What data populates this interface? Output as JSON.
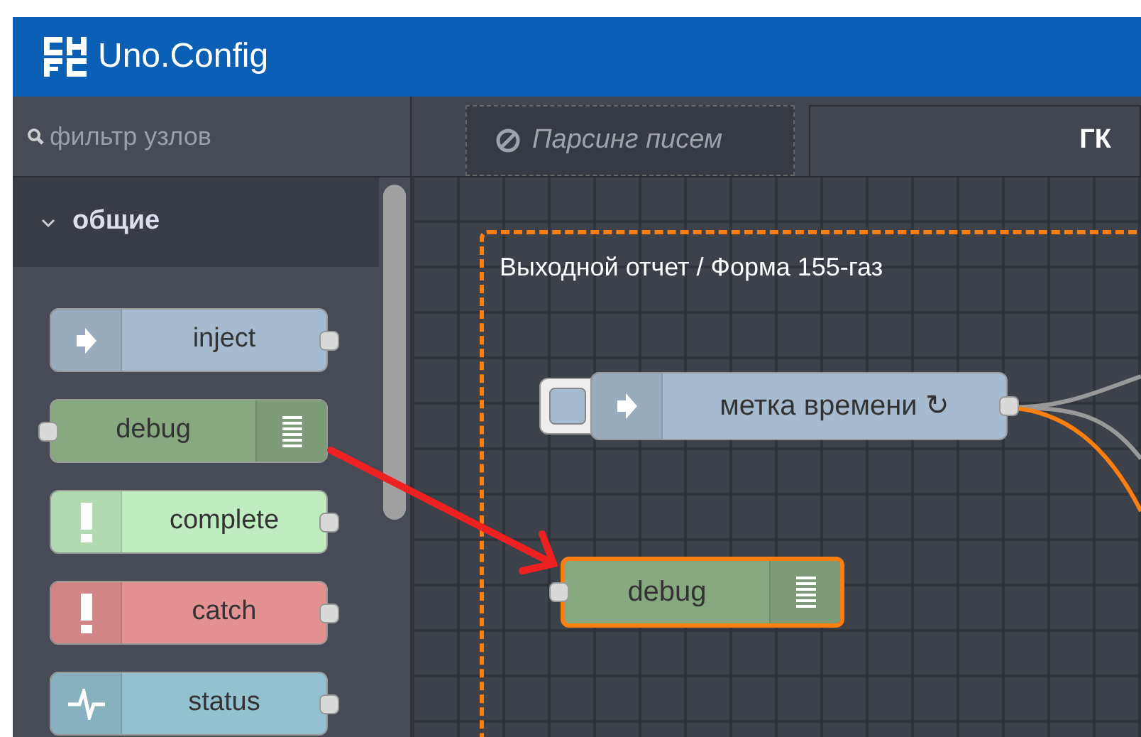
{
  "app": {
    "title": "Uno.Config"
  },
  "palette": {
    "filter": {
      "placeholder": "фильтр узлов"
    },
    "category": {
      "label": "общие",
      "expanded": true
    },
    "nodes": [
      {
        "label": "inject",
        "color": "#a6bbcf",
        "kind": "inject"
      },
      {
        "label": "debug",
        "color": "#87a980",
        "kind": "debug"
      },
      {
        "label": "complete",
        "color": "#c0edc0",
        "kind": "alert"
      },
      {
        "label": "catch",
        "color": "#e49191",
        "kind": "alert"
      },
      {
        "label": "status",
        "color": "#94c1d0",
        "kind": "status"
      }
    ]
  },
  "tabs": [
    {
      "label": "Парсинг писем",
      "disabled": true,
      "selected": false
    },
    {
      "label": "ГК",
      "disabled": false,
      "selected": true
    }
  ],
  "canvas": {
    "group": {
      "label": "Выходной отчет / Форма 155-газ",
      "selected": true
    },
    "nodes": [
      {
        "label": "метка времени ↻",
        "color": "#a6bbcf",
        "kind": "inject",
        "button": true,
        "selected": false
      },
      {
        "label": "debug",
        "color": "#87a980",
        "kind": "debug",
        "button": false,
        "selected": true
      }
    ]
  }
}
